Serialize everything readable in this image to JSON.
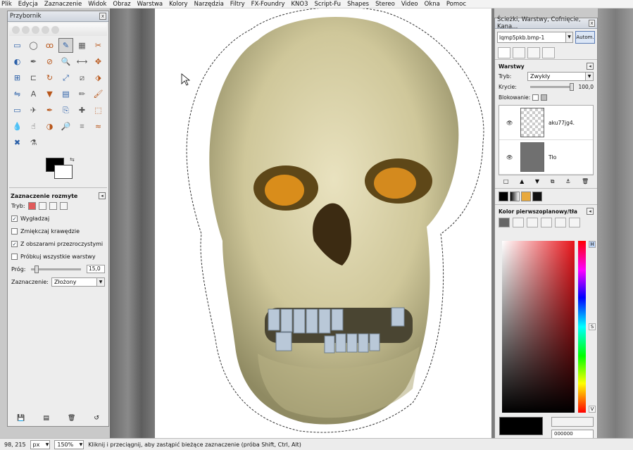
{
  "menu": [
    "Plik",
    "Edycja",
    "Zaznaczenie",
    "Widok",
    "Obraz",
    "Warstwa",
    "Kolory",
    "Narzędzia",
    "Filtry",
    "FX-Foundry",
    "KNO3",
    "Script-Fu",
    "Shapes",
    "Stereo",
    "Video",
    "Okna",
    "Pomoc"
  ],
  "toolbox": {
    "title": "Przybornik",
    "close": "x",
    "tools": [
      "rect-select-icon",
      "ellipse-select-icon",
      "free-select-icon",
      "fuzzy-select-icon",
      "color-select-icon",
      "scissors-icon",
      "foreground-select-icon",
      "paths-icon",
      "color-picker-icon",
      "zoom-icon",
      "measure-icon",
      "move-icon",
      "align-icon",
      "crop-icon",
      "rotate-icon",
      "scale-icon",
      "shear-icon",
      "perspective-icon",
      "flip-icon",
      "text-icon",
      "bucket-fill-icon",
      "blend-icon",
      "pencil-icon",
      "paintbrush-icon",
      "eraser-icon",
      "airbrush-icon",
      "ink-icon",
      "clone-icon",
      "heal-icon",
      "perspective-clone-icon",
      "blur-icon",
      "smudge-icon",
      "dodge-burn-icon",
      "magnify-icon",
      "cage-icon",
      "warp-icon",
      "star-icon",
      "script-icon"
    ]
  },
  "tool_options": {
    "title": "Zaznaczenie rozmyte",
    "mode_label": "Tryb:",
    "antialias": "Wygładzaj",
    "feather": "Zmiękczaj krawędzie",
    "transparent": "Z obszarami przezroczystymi",
    "sample_merged": "Próbkuj wszystkie warstwy",
    "threshold_label": "Próg:",
    "threshold_value": "15,0",
    "threshold_fraction": 0.06,
    "select_by_label": "Zaznaczenie:",
    "select_by_value": "Złożony"
  },
  "dock": {
    "title": "Ścieżki, Warstwy, Cofnięcie, Kana...",
    "image": "lqmp5pkb.bmp-1",
    "auto": "Autom.",
    "layers_title": "Warstwy",
    "mode_label": "Tryb:",
    "mode_value": "Zwykły",
    "opacity_label": "Krycie:",
    "opacity_value": "100,0",
    "lock_label": "Blokowanie:",
    "layers": [
      {
        "name": "aku77jg4."
      },
      {
        "name": "Tło"
      }
    ],
    "fgbg_title": "Kolor pierwszoplanowy/tła",
    "hsv": [
      "H",
      "S",
      "V"
    ],
    "hex": "000000"
  },
  "status": {
    "coords": "98, 215",
    "unit": "px",
    "zoom": "150%",
    "message": "Kliknij i przeciągnij, aby zastąpić bieżące zaznaczenie (próba Shift, Ctrl, Alt)"
  },
  "colors": {
    "foreground": "#000000",
    "background": "#ffffff",
    "skull": "#d6cfa4"
  }
}
